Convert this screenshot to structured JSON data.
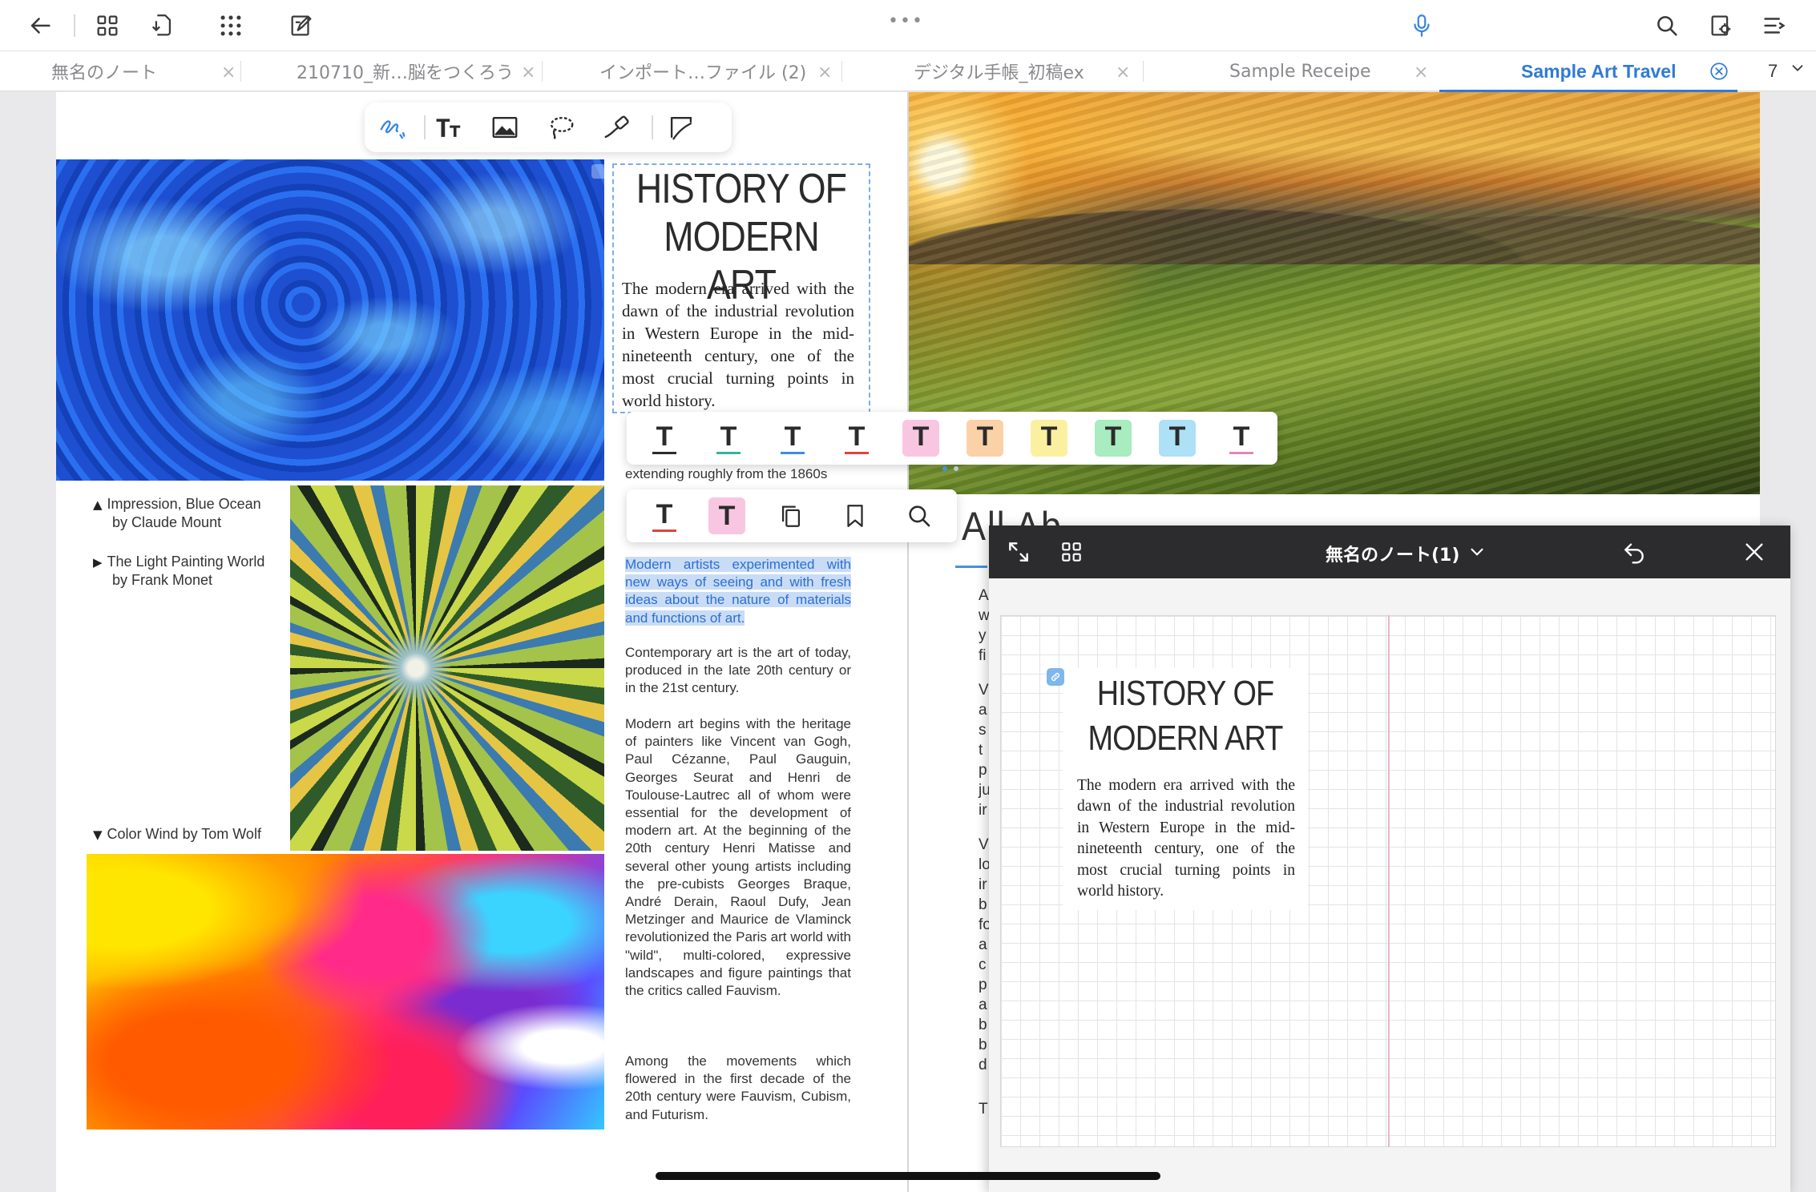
{
  "app": {
    "more_dots": "•••"
  },
  "topbar": {
    "icons": [
      "back-arrow-icon",
      "grid-view-icon",
      "export-icon",
      "apps-icon",
      "edit-note-icon",
      "microphone-icon",
      "search-icon",
      "page-settings-icon",
      "outline-menu-icon"
    ]
  },
  "tabs": {
    "items": [
      {
        "label": "無名のノート",
        "active": false
      },
      {
        "label": "210710_新…脳をつくろう",
        "active": false
      },
      {
        "label": "インポート…ファイル (2)",
        "active": false
      },
      {
        "label": "デジタル手帳_初稿ex",
        "active": false
      },
      {
        "label": "Sample Receipe",
        "active": false
      },
      {
        "label": "Sample Art Travel",
        "active": true
      }
    ],
    "close_glyph": "×",
    "count": "7"
  },
  "palette": {
    "tools": [
      "pen-tool-icon",
      "text-tool-icon",
      "image-tool-icon",
      "lasso-tool-icon",
      "laser-pointer-icon",
      "shape-tool-icon"
    ]
  },
  "left_page": {
    "captions": [
      {
        "tri": "▲",
        "line1": "Impression, Blue Ocean",
        "line2": "by Claude Mount"
      },
      {
        "tri": "▶",
        "line1": "The Light Painting World",
        "line2": "by Frank Monet"
      },
      {
        "tri": "▼",
        "line1": "Color Wind by Tom Wolf",
        "line2": ""
      }
    ],
    "title": "HISTORY OF MODERN ART",
    "intro": "The modern era arrived with the dawn of the industrial revolution in Western Europe in the mid-nineteenth century, one of the most crucial turning points in world history.",
    "partial_line": "extending roughly from the 1860s",
    "highlighted": "Modern artists experimented with new ways of seeing and with fresh ideas about the nature of materials and functions of art.",
    "para_contemporary": "Contemporary art is the art of today, produced in the late 20th century or in the 21st century.",
    "para_modern": "Modern art begins with the heritage of painters like Vincent van Gogh, Paul Cézanne, Paul Gauguin, Georges Seurat and Henri de Toulouse-Lautrec all of whom were essential for the development of modern art. At the beginning of the 20th century Henri Matisse and several other young artists including the pre-cubists Georges Braque, André Derain, Raoul Dufy, Jean Metzinger and Maurice de Vlaminck revolutionized the Paris art world with \"wild\", multi-colored, expressive landscapes and figure paintings that the critics called Fauvism.",
    "para_movements": "Among the movements which flowered in the first decade of the 20th century were Fauvism, Cubism, and Futurism."
  },
  "text_style_strip": {
    "glyph": "T",
    "styles": [
      {
        "name": "text-style-underline-black",
        "line": "#2b2b2b",
        "bg": "#ffffff"
      },
      {
        "name": "text-style-underline-teal",
        "line": "#33b3a6",
        "bg": "#ffffff"
      },
      {
        "name": "text-style-underline-blue",
        "line": "#3a8ee6",
        "bg": "#ffffff"
      },
      {
        "name": "text-style-underline-red",
        "line": "#e0443c",
        "bg": "#ffffff"
      },
      {
        "name": "text-style-highlight-pink",
        "line": "",
        "bg": "#f9c6e2"
      },
      {
        "name": "text-style-highlight-orange",
        "line": "",
        "bg": "#fbd1a8"
      },
      {
        "name": "text-style-highlight-yellow",
        "line": "",
        "bg": "#fbf0a0"
      },
      {
        "name": "text-style-highlight-green",
        "line": "",
        "bg": "#a8ecbf"
      },
      {
        "name": "text-style-highlight-blue",
        "line": "",
        "bg": "#aee0f6"
      },
      {
        "name": "text-style-underline-pink",
        "line": "#e982c0",
        "bg": "#ffffff"
      }
    ]
  },
  "action_strip": {
    "glyph": "T",
    "items": [
      "underline-red-button",
      "highlight-pink-button",
      "copy-icon",
      "bookmark-icon",
      "search-icon"
    ]
  },
  "right_page": {
    "heading_fragment": "All Ab...",
    "letters": [
      "A",
      "w",
      "y",
      "fi",
      "V",
      "a",
      "s",
      "t",
      "p",
      "ju",
      "ir",
      "V",
      "lo",
      "ir",
      "b",
      "fo",
      "a",
      "c",
      "p",
      "a",
      "b",
      "b",
      "d",
      "T"
    ]
  },
  "panel": {
    "title": "無名のノート(1)",
    "mini_title": "HISTORY OF MODERN ART",
    "mini_para": "The modern era arrived with the dawn of the industrial revolution in Western Europe in the mid-nineteenth century, one of the most crucial turning points in world history."
  },
  "colors": {
    "accent": "#2f7ad8",
    "highlight_bg": "#c8dcf6",
    "highlight_text": "#2e6fd0",
    "panel_header": "#2c2c2e"
  }
}
